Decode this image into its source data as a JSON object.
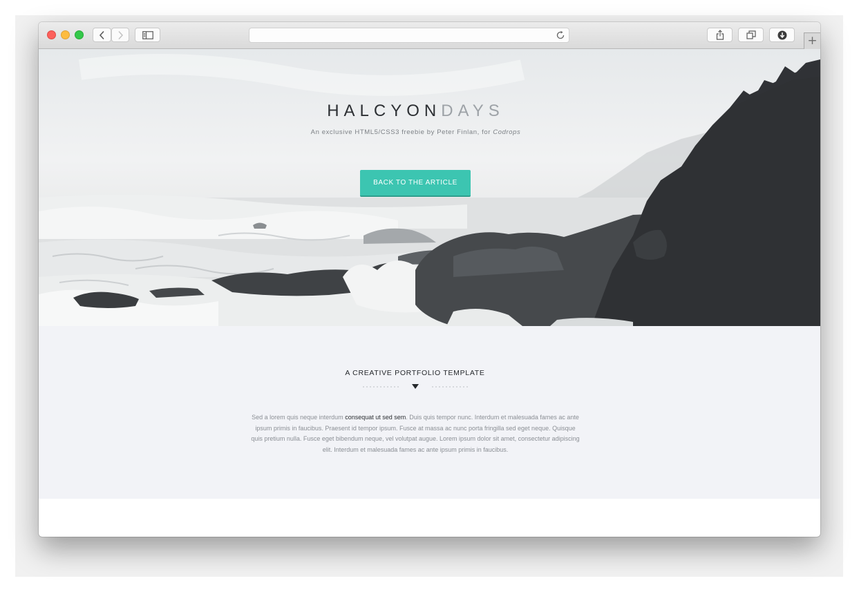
{
  "hero": {
    "title_part1": "HALCYON",
    "title_part2": "DAYS",
    "subtitle_prefix": "An exclusive HTML5/CSS3 freebie by Peter Finlan, for ",
    "subtitle_link": "Codrops",
    "cta_label": "BACK TO THE ARTICLE"
  },
  "content": {
    "heading": "A CREATIVE PORTFOLIO TEMPLATE",
    "paragraph_before": "Sed a lorem quis neque interdum ",
    "paragraph_emphasis": "consequat ut sed sem",
    "paragraph_after": ". Duis quis tempor nunc. Interdum et malesuada fames ac ante ipsum primis in faucibus. Praesent id tempor ipsum. Fusce at massa ac nunc porta fringilla sed eget neque. Quisque quis pretium nulla. Fusce eget bibendum neque, vel volutpat augue. Lorem ipsum dolor sit amet, consectetur adipiscing elit. Interdum et malesuada fames ac ante ipsum primis in faucibus."
  },
  "colors": {
    "accent": "#3cc5b1",
    "content_background": "#f2f3f7",
    "title_dark": "#2d3034",
    "title_light": "#9da2a7"
  },
  "icons": {
    "toolbar": [
      "back-icon",
      "forward-icon",
      "sidebar-icon",
      "reload-icon",
      "share-icon",
      "tabs-icon",
      "downloads-icon",
      "new-tab-icon"
    ],
    "divider": "triangle-down-icon"
  }
}
